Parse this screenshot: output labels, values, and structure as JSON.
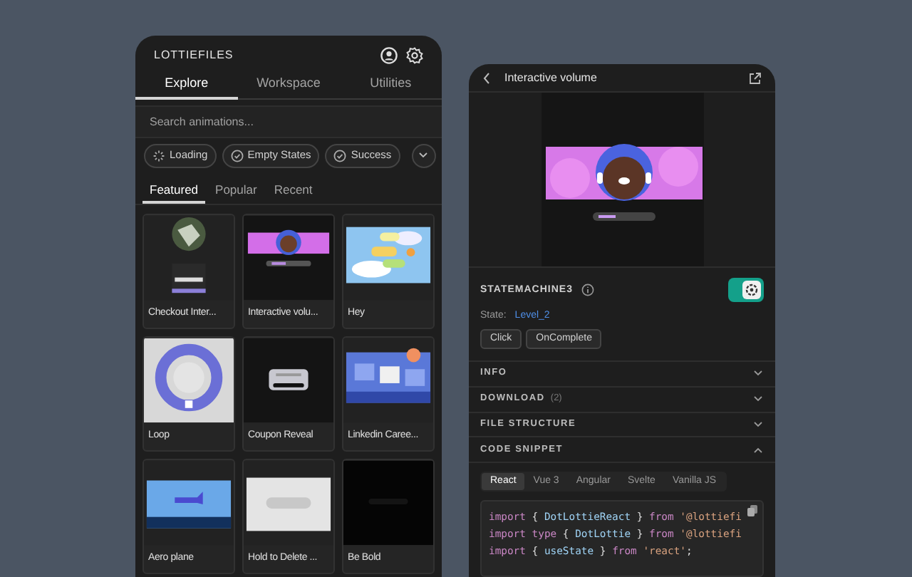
{
  "library_panel": {
    "brand": "LOTTIEFILES",
    "tabs": [
      {
        "label": "Explore",
        "selected": true
      },
      {
        "label": "Workspace",
        "selected": false
      },
      {
        "label": "Utilities",
        "selected": false
      }
    ],
    "search": {
      "placeholder": "Search animations..."
    },
    "chips": [
      {
        "label": "Loading",
        "kind": "loading"
      },
      {
        "label": "Empty States",
        "kind": "check"
      },
      {
        "label": "Success",
        "kind": "check"
      }
    ],
    "subtabs": [
      {
        "label": "Featured",
        "selected": true
      },
      {
        "label": "Popular",
        "selected": false
      },
      {
        "label": "Recent",
        "selected": false
      }
    ],
    "cards": [
      {
        "title": "Checkout Inter...",
        "kind": "picture"
      },
      {
        "title": "Interactive volu...",
        "kind": "picture"
      },
      {
        "title": "Hey",
        "kind": "picture"
      },
      {
        "title": "Loop",
        "kind": "picture"
      },
      {
        "title": "Coupon Reveal",
        "kind": "picture"
      },
      {
        "title": "Linkedin Caree...",
        "kind": "picture"
      },
      {
        "title": "Aero plane",
        "kind": "picture"
      },
      {
        "title": "Hold to Delete ...",
        "kind": "picture"
      },
      {
        "title": "Be Bold",
        "kind": "picture"
      }
    ]
  },
  "detail_panel": {
    "title": "Interactive volume",
    "preview": {
      "kind": "picture"
    },
    "state_machine": {
      "name": "STATEMACHINE3",
      "state_label": "State:",
      "state_value": "Level_2",
      "events": [
        "Click",
        "OnComplete"
      ]
    },
    "sections": [
      {
        "title": "INFO",
        "expanded": false
      },
      {
        "title": "DOWNLOAD",
        "count": "(2)",
        "expanded": false
      },
      {
        "title": "FILE STRUCTURE",
        "expanded": false
      },
      {
        "title": "CODE SNIPPET",
        "expanded": true
      }
    ],
    "code_tabs": [
      {
        "label": "React",
        "selected": true
      },
      {
        "label": "Vue 3",
        "selected": false
      },
      {
        "label": "Angular",
        "selected": false
      },
      {
        "label": "Svelte",
        "selected": false
      },
      {
        "label": "Vanilla JS",
        "selected": false
      }
    ],
    "code_lines": [
      [
        {
          "kind": "keyword",
          "text": "import"
        },
        {
          "kind": "plain",
          "text": " { "
        },
        {
          "kind": "name",
          "text": "DotLottieReact"
        },
        {
          "kind": "plain",
          "text": " } "
        },
        {
          "kind": "keyword",
          "text": "from"
        },
        {
          "kind": "string",
          "text": " '@lottiefi"
        }
      ],
      [
        {
          "kind": "keyword",
          "text": "import type"
        },
        {
          "kind": "plain",
          "text": " { "
        },
        {
          "kind": "name",
          "text": "DotLottie"
        },
        {
          "kind": "plain",
          "text": " } "
        },
        {
          "kind": "keyword",
          "text": "from"
        },
        {
          "kind": "string",
          "text": " '@lottiefi"
        }
      ],
      [
        {
          "kind": "keyword",
          "text": "import"
        },
        {
          "kind": "plain",
          "text": " { "
        },
        {
          "kind": "name",
          "text": "useState"
        },
        {
          "kind": "plain",
          "text": " } "
        },
        {
          "kind": "keyword",
          "text": "from"
        },
        {
          "kind": "string",
          "text": " 'react'"
        },
        {
          "kind": "plain",
          "text": ";"
        }
      ]
    ]
  }
}
